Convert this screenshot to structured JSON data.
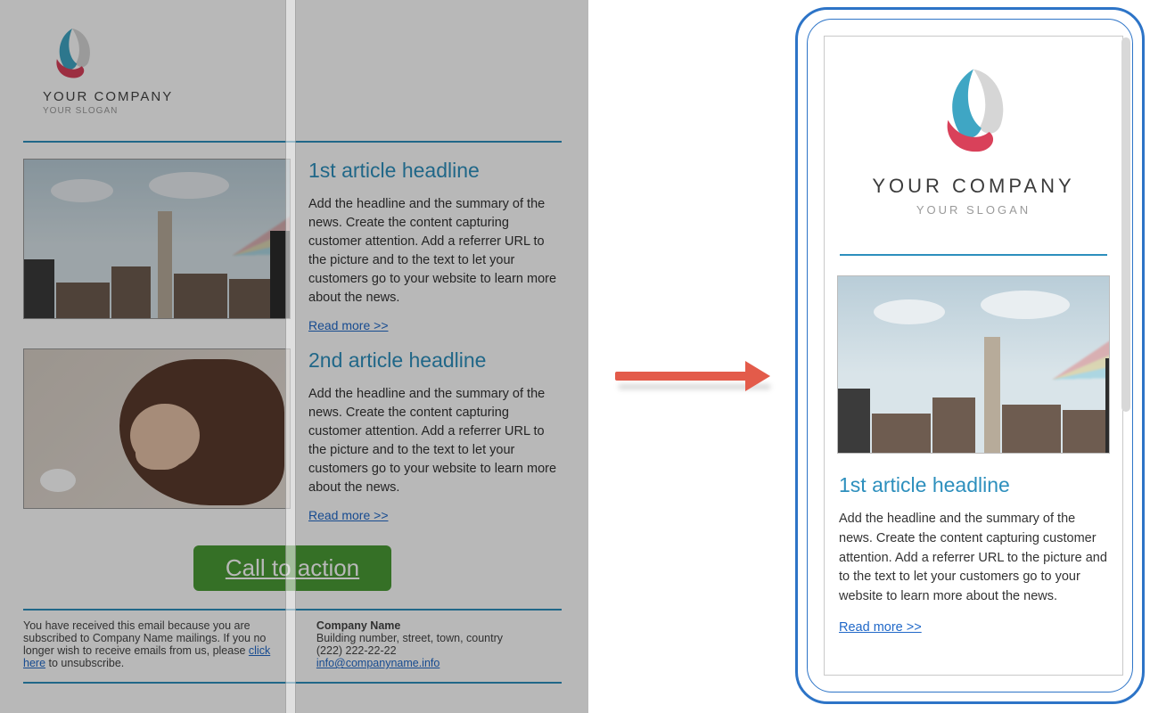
{
  "brand": {
    "company": "YOUR COMPANY",
    "slogan": "YOUR SLOGAN"
  },
  "desktop": {
    "articles": [
      {
        "headline": "1st article headline",
        "summary": "Add the headline and the summary of the news. Create the content capturing customer attention. Add a referrer URL to the picture and to the text to let your customers go to your website to learn more about the news.",
        "read_more": "Read more >>"
      },
      {
        "headline": "2nd article headline",
        "summary": "Add the headline and the summary of the news. Create the content capturing customer attention. Add a referrer URL to the picture and to the text to let your customers go to your website to learn more about the news.",
        "read_more": "Read more >>"
      }
    ],
    "cta": "Call to action",
    "footer": {
      "unsub_pre": "You have received this email because you are subscribed to Company Name mailings. If you no longer wish to receive emails from us, please ",
      "unsub_link": "click here",
      "unsub_post": " to unsubscribe.",
      "company_label": "Company Name",
      "address": "Building number, street, town, country",
      "phone": "(222) 222-22-22",
      "email": "info@companyname.info"
    }
  },
  "mobile": {
    "headline": "1st article headline",
    "summary": "Add the headline and the summary of the news. Create the content capturing customer attention. Add a referrer URL to the picture and to the text to let your customers go to your website to learn more about the news.",
    "read_more": "Read more >>"
  }
}
